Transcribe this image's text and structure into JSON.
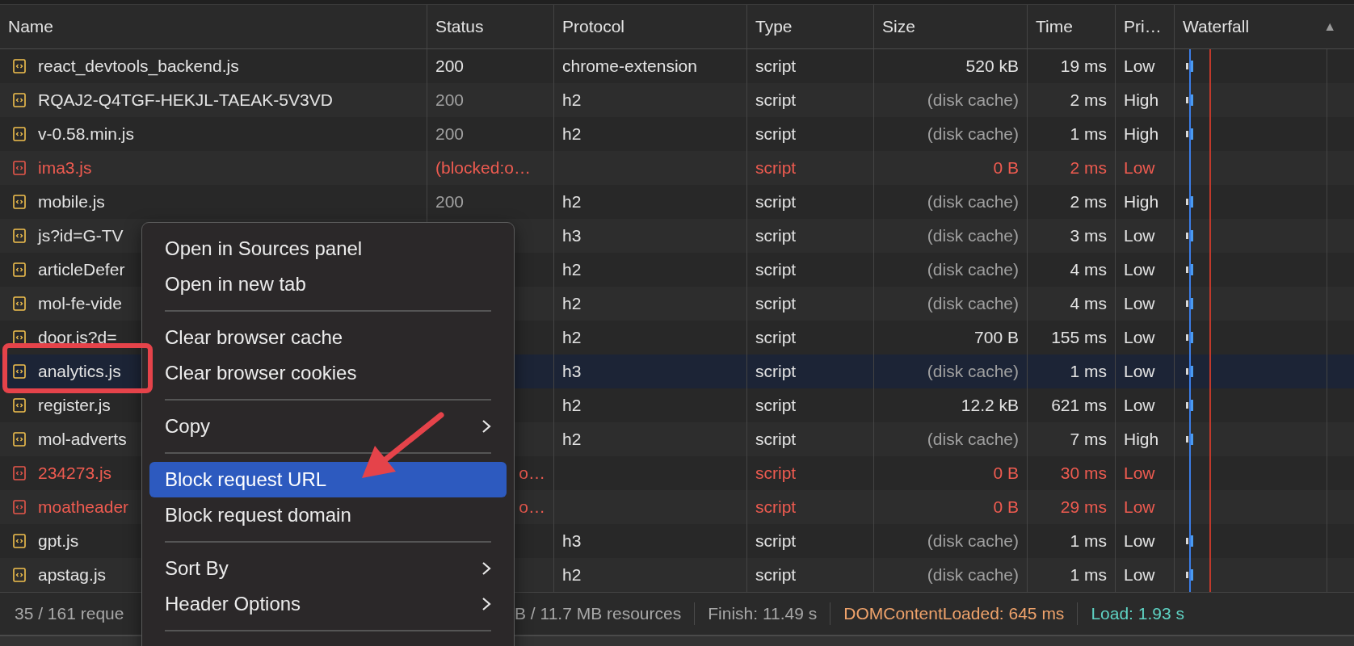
{
  "table": {
    "columns": [
      {
        "label": "Name"
      },
      {
        "label": "Status"
      },
      {
        "label": "Protocol"
      },
      {
        "label": "Type"
      },
      {
        "label": "Size"
      },
      {
        "label": "Time"
      },
      {
        "label": "Pri…"
      },
      {
        "label": "Waterfall",
        "sort_indicator": "▲"
      }
    ],
    "rows": [
      {
        "name": "react_devtools_backend.js",
        "status": "200",
        "protocol": "chrome-extension",
        "type": "script",
        "size": "520 kB",
        "time": "19 ms",
        "priority": "Low",
        "blocked": false,
        "cached": false,
        "selected": false
      },
      {
        "name": "RQAJ2-Q4TGF-HEKJL-TAEAK-5V3VD",
        "status": "200",
        "protocol": "h2",
        "type": "script",
        "size": "(disk cache)",
        "time": "2 ms",
        "priority": "High",
        "blocked": false,
        "cached": true,
        "selected": false
      },
      {
        "name": "v-0.58.min.js",
        "status": "200",
        "protocol": "h2",
        "type": "script",
        "size": "(disk cache)",
        "time": "1 ms",
        "priority": "High",
        "blocked": false,
        "cached": true,
        "selected": false
      },
      {
        "name": "ima3.js",
        "status": "(blocked:o…",
        "type": "script",
        "size": "0 B",
        "time": "2 ms",
        "priority": "Low",
        "blocked": true,
        "selected": false
      },
      {
        "name": "mobile.js",
        "status": "200",
        "protocol": "h2",
        "type": "script",
        "size": "(disk cache)",
        "time": "2 ms",
        "priority": "High",
        "blocked": false,
        "cached": true,
        "selected": false
      },
      {
        "name": "js?id=G-TV",
        "protocol": "h3",
        "type": "script",
        "size": "(disk cache)",
        "time": "3 ms",
        "priority": "Low",
        "blocked": false,
        "cached": true,
        "selected": false
      },
      {
        "name": "articleDefer",
        "protocol": "h2",
        "type": "script",
        "size": "(disk cache)",
        "time": "4 ms",
        "priority": "Low",
        "blocked": false,
        "cached": true,
        "selected": false
      },
      {
        "name": "mol-fe-vide",
        "protocol": "h2",
        "type": "script",
        "size": "(disk cache)",
        "time": "4 ms",
        "priority": "Low",
        "blocked": false,
        "cached": true,
        "selected": false
      },
      {
        "name": "door.js?d=",
        "protocol": "h2",
        "type": "script",
        "size": "700 B",
        "time": "155 ms",
        "priority": "Low",
        "blocked": false,
        "cached": false,
        "selected": false
      },
      {
        "name": "analytics.js",
        "protocol": "h3",
        "type": "script",
        "size": "(disk cache)",
        "time": "1 ms",
        "priority": "Low",
        "blocked": false,
        "cached": true,
        "selected": true
      },
      {
        "name": "register.js",
        "protocol": "h2",
        "type": "script",
        "size": "12.2 kB",
        "time": "621 ms",
        "priority": "Low",
        "blocked": false,
        "cached": false,
        "selected": false
      },
      {
        "name": "mol-adverts",
        "protocol": "h2",
        "type": "script",
        "size": "(disk cache)",
        "time": "7 ms",
        "priority": "High",
        "blocked": false,
        "cached": true,
        "selected": false
      },
      {
        "name": "234273.js",
        "status": "o…",
        "covered": true,
        "type": "script",
        "size": "0 B",
        "time": "30 ms",
        "priority": "Low",
        "blocked": true,
        "selected": false
      },
      {
        "name": "moatheader",
        "status": "o…",
        "covered": true,
        "type": "script",
        "size": "0 B",
        "time": "29 ms",
        "priority": "Low",
        "blocked": true,
        "selected": false
      },
      {
        "name": "gpt.js",
        "protocol": "h3",
        "type": "script",
        "size": "(disk cache)",
        "time": "1 ms",
        "priority": "Low",
        "blocked": false,
        "cached": true,
        "selected": false
      },
      {
        "name": "apstag.js",
        "protocol": "h2",
        "type": "script",
        "size": "(disk cache)",
        "time": "1 ms",
        "priority": "Low",
        "blocked": false,
        "cached": true,
        "selected": false
      }
    ]
  },
  "status_bar": {
    "requests": "35 / 161 reque",
    "resources": "B / 11.7 MB resources",
    "finish": "Finish: 11.49 s",
    "dom_content_loaded": "DOMContentLoaded: 645 ms",
    "load": "Load: 1.93 s"
  },
  "context_menu": {
    "items": [
      {
        "kind": "item",
        "label": "Open in Sources panel",
        "submenu": false,
        "selected": false
      },
      {
        "kind": "item",
        "label": "Open in new tab",
        "submenu": false,
        "selected": false
      },
      {
        "kind": "separator"
      },
      {
        "kind": "item",
        "label": "Clear browser cache",
        "submenu": false,
        "selected": false
      },
      {
        "kind": "item",
        "label": "Clear browser cookies",
        "submenu": false,
        "selected": false
      },
      {
        "kind": "separator"
      },
      {
        "kind": "item",
        "label": "Copy",
        "submenu": true,
        "selected": false
      },
      {
        "kind": "separator"
      },
      {
        "kind": "item",
        "label": "Block request URL",
        "submenu": false,
        "selected": true
      },
      {
        "kind": "item",
        "label": "Block request domain",
        "submenu": false,
        "selected": false
      },
      {
        "kind": "separator"
      },
      {
        "kind": "item",
        "label": "Sort By",
        "submenu": true,
        "selected": false
      },
      {
        "kind": "item",
        "label": "Header Options",
        "submenu": true,
        "selected": false
      },
      {
        "kind": "separator"
      }
    ]
  }
}
